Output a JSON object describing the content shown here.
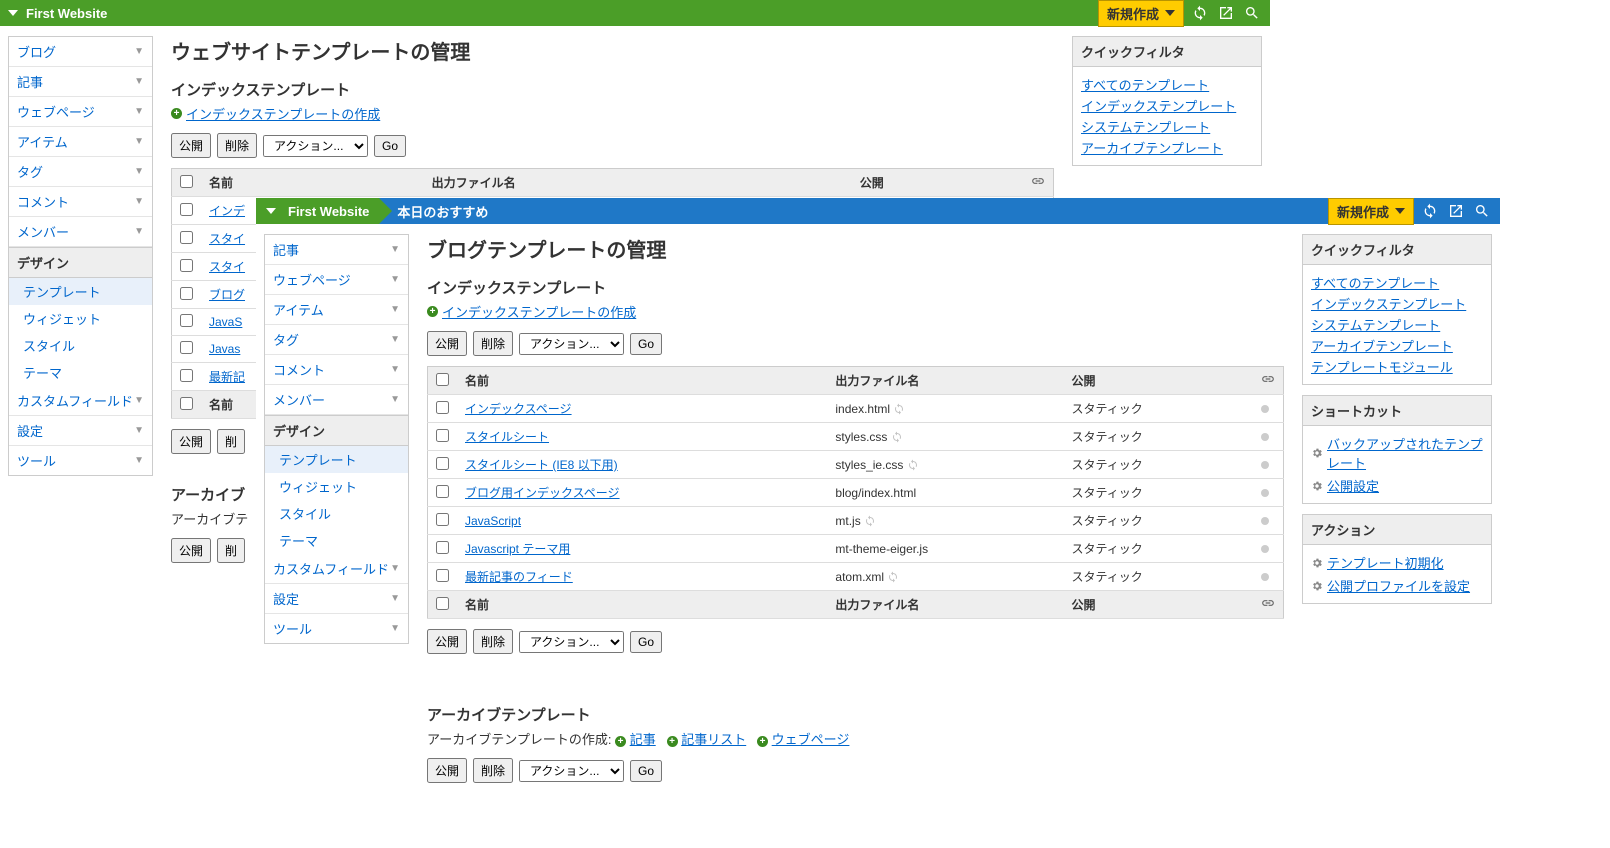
{
  "layer1": {
    "site_name": "First Website",
    "new_button": "新規作成",
    "sidenav": {
      "items_top": [
        "ブログ",
        "記事",
        "ウェブページ",
        "アイテム",
        "タグ",
        "コメント",
        "メンバー"
      ],
      "design_head": "デザイン",
      "design_items": [
        "テンプレート",
        "ウィジェット",
        "スタイル",
        "テーマ"
      ],
      "items_bottom": [
        "カスタムフィールド",
        "設定",
        "ツール"
      ]
    },
    "page_title": "ウェブサイトテンプレートの管理",
    "section_title": "インデックステンプレート",
    "create_link": "インデックステンプレートの作成",
    "btn_publish": "公開",
    "btn_delete": "削除",
    "action_placeholder": "アクション...",
    "btn_go": "Go",
    "cols": {
      "name": "名前",
      "file": "出力ファイル名",
      "publish": "公開"
    },
    "rows": [
      "インデ",
      "スタイ",
      "スタイ",
      "ブログ",
      "JavaS",
      "Javas",
      "最新記"
    ],
    "archive_title": "アーカイブ",
    "archive_sub": "アーカイブテ",
    "quickfilter": {
      "title": "クイックフィルタ",
      "links": [
        "すべてのテンプレート",
        "インデックステンプレート",
        "システムテンプレート",
        "アーカイブテンプレート"
      ]
    }
  },
  "layer2": {
    "site_name": "First Website",
    "crumb_sub": "本日のおすすめ",
    "new_button": "新規作成",
    "sidenav": {
      "items_top": [
        "記事",
        "ウェブページ",
        "アイテム",
        "タグ",
        "コメント",
        "メンバー"
      ],
      "design_head": "デザイン",
      "design_items": [
        "テンプレート",
        "ウィジェット",
        "スタイル",
        "テーマ"
      ],
      "items_bottom": [
        "カスタムフィールド",
        "設定",
        "ツール"
      ]
    },
    "page_title": "ブログテンプレートの管理",
    "section_title": "インデックステンプレート",
    "create_link": "インデックステンプレートの作成",
    "btn_publish": "公開",
    "btn_delete": "削除",
    "action_placeholder": "アクション...",
    "btn_go": "Go",
    "cols": {
      "name": "名前",
      "file": "出力ファイル名",
      "publish": "公開"
    },
    "rows": [
      {
        "name": "インデックスページ",
        "file": "index.html",
        "refresh": true,
        "publish": "スタティック"
      },
      {
        "name": "スタイルシート",
        "file": "styles.css",
        "refresh": true,
        "publish": "スタティック"
      },
      {
        "name": "スタイルシート (IE8 以下用)",
        "file": "styles_ie.css",
        "refresh": true,
        "publish": "スタティック"
      },
      {
        "name": "ブログ用インデックスページ",
        "file": "blog/index.html",
        "refresh": false,
        "publish": "スタティック"
      },
      {
        "name": "JavaScript",
        "file": "mt.js",
        "refresh": true,
        "publish": "スタティック"
      },
      {
        "name": "Javascript テーマ用",
        "file": "mt-theme-eiger.js",
        "refresh": false,
        "publish": "スタティック"
      },
      {
        "name": "最新記事のフィード",
        "file": "atom.xml",
        "refresh": true,
        "publish": "スタティック"
      }
    ],
    "archive_title": "アーカイブテンプレート",
    "archive_sub": "アーカイブテンプレートの作成:",
    "archive_links": [
      "記事",
      "記事リスト",
      "ウェブページ"
    ],
    "quickfilter": {
      "title": "クイックフィルタ",
      "links": [
        "すべてのテンプレート",
        "インデックステンプレート",
        "システムテンプレート",
        "アーカイブテンプレート",
        "テンプレートモジュール"
      ]
    },
    "shortcut": {
      "title": "ショートカット",
      "links": [
        "バックアップされたテンプレート",
        "公開設定"
      ]
    },
    "actions": {
      "title": "アクション",
      "links": [
        "テンプレート初期化",
        "公開プロファイルを設定"
      ]
    }
  }
}
